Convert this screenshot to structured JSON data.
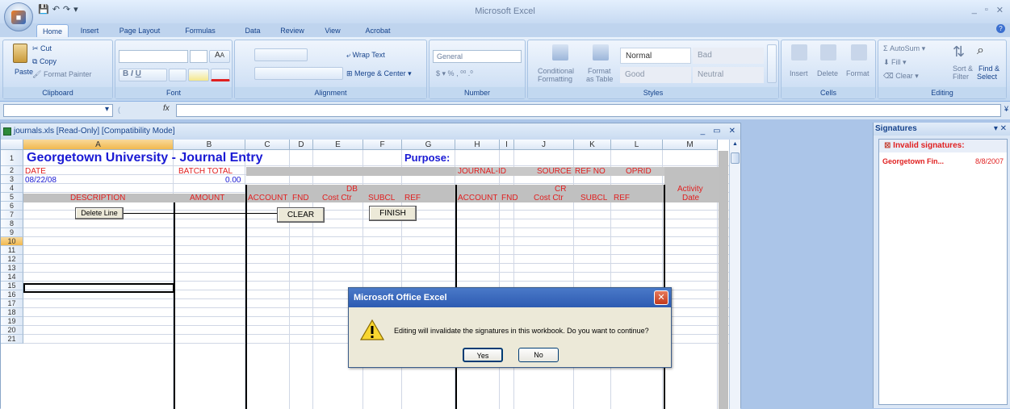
{
  "app": {
    "title": "Microsoft Excel",
    "window_controls": [
      "_",
      "▫",
      "✕"
    ]
  },
  "qat": {
    "items": [
      "save",
      "undo",
      "redo"
    ]
  },
  "tabs": [
    "Home",
    "Insert",
    "Page Layout",
    "Formulas",
    "Data",
    "Review",
    "View",
    "Acrobat"
  ],
  "ribbon": {
    "clipboard": {
      "label": "Clipboard",
      "paste": "Paste",
      "cut": "Cut",
      "copy": "Copy",
      "format_painter": "Format Painter"
    },
    "font": {
      "label": "Font",
      "bold": "B",
      "italic": "I",
      "underline": "U",
      "grow": "A",
      "shrink": "A"
    },
    "alignment": {
      "label": "Alignment",
      "wrap": "Wrap Text",
      "merge": "Merge & Center"
    },
    "number": {
      "label": "Number",
      "format": "General",
      "currency": "$",
      "percent": "%",
      "comma": ","
    },
    "styles": {
      "label": "Styles",
      "conditional": "Conditional",
      "conditional2": "Formatting",
      "format_table": "Format",
      "format_table2": "as Table",
      "normal": "Normal",
      "bad": "Bad",
      "good": "Good",
      "neutral": "Neutral"
    },
    "cells": {
      "label": "Cells",
      "insert": "Insert",
      "delete": "Delete",
      "format": "Format"
    },
    "editing": {
      "label": "Editing",
      "autosum": "AutoSum",
      "fill": "Fill",
      "clear": "Clear",
      "sort": "Sort &",
      "sort2": "Filter",
      "find": "Find &",
      "find2": "Select"
    }
  },
  "formula_bar": {
    "fx": "fx",
    "value": ""
  },
  "workbook": {
    "title": "journals.xls  [Read-Only]  [Compatibility Mode]",
    "controls": [
      "_",
      "▭",
      "✕"
    ]
  },
  "sheet": {
    "columns": [
      "A",
      "B",
      "C",
      "D",
      "E",
      "F",
      "G",
      "H",
      "I",
      "J",
      "K",
      "L",
      "M"
    ],
    "rows": [
      "1",
      "2",
      "3",
      "4",
      "5",
      "6",
      "7",
      "8",
      "9",
      "10",
      "11",
      "12",
      "13",
      "14",
      "15",
      "16",
      "17",
      "18",
      "19",
      "20",
      "21"
    ],
    "title": "Georgetown University - Journal Entry",
    "purpose": "Purpose:",
    "row2": {
      "date": "DATE",
      "batch_total": "BATCH TOTAL",
      "journal_id": "JOURNAL-ID",
      "source": "SOURCE",
      "ref_no": "REF NO",
      "oprid": "OPRID"
    },
    "row3": {
      "date_value": "08/22/08",
      "batch_value": "0.00"
    },
    "row4": {
      "db": "DB",
      "cr": "CR",
      "activity": "Activity"
    },
    "row5": {
      "description": "DESCRIPTION",
      "amount": "AMOUNT",
      "account": "ACCOUNT",
      "fnd": "FND",
      "cost_ctr": "Cost Ctr",
      "subcl": "SUBCL",
      "ref": "REF",
      "account2": "ACCOUNT",
      "fnd2": "FND",
      "cost_ctr2": "Cost Ctr",
      "subcl2": "SUBCL",
      "ref2": "REF",
      "date": "Date"
    },
    "buttons": {
      "delete_line": "Delete Line",
      "clear": "CLEAR",
      "finish": "FINISH"
    }
  },
  "signatures": {
    "title": "Signatures",
    "invalid_header": "Invalid signatures:",
    "entries": [
      {
        "name": "Georgetown Fin...",
        "date": "8/8/2007"
      }
    ]
  },
  "dialog": {
    "title": "Microsoft Office Excel",
    "message": "Editing will invalidate the signatures in this workbook. Do you want to continue?",
    "yes": "Yes",
    "no": "No"
  }
}
